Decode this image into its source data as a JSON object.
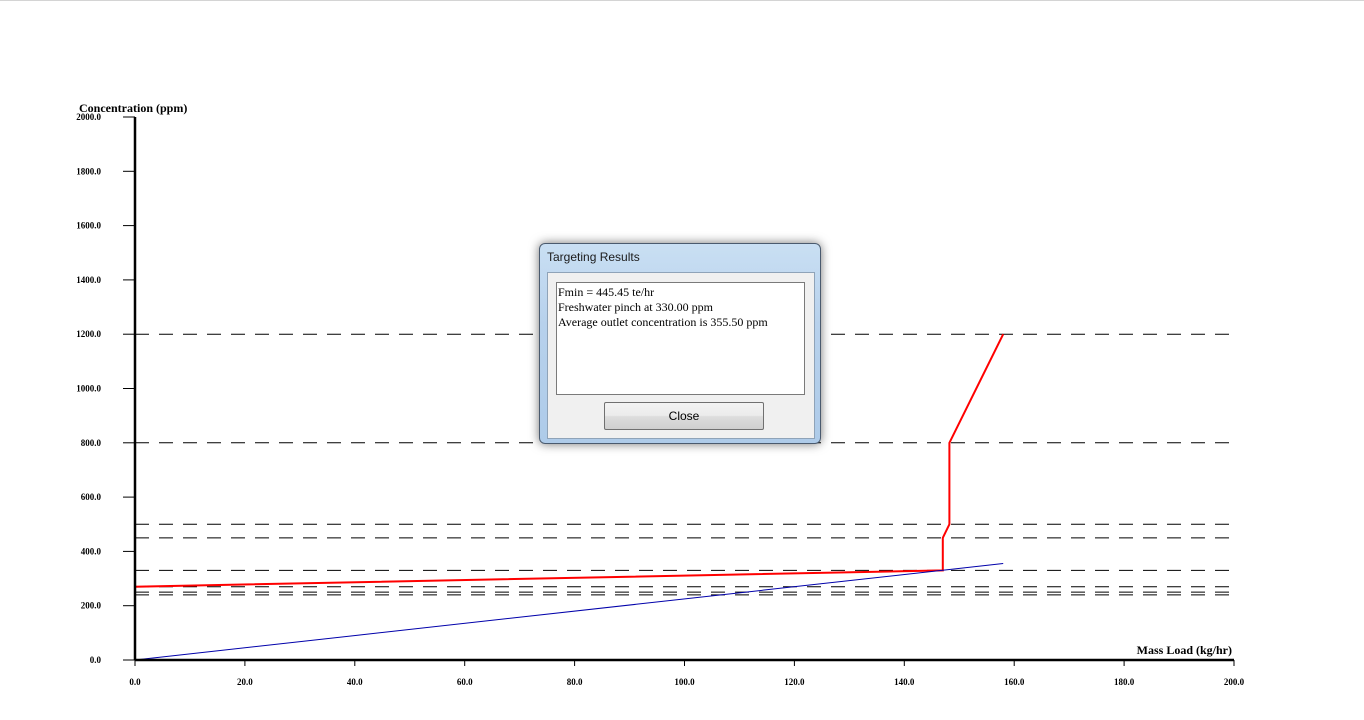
{
  "chart_data": {
    "type": "line",
    "xlabel": "Mass Load (kg/hr)",
    "ylabel": "Concentration (ppm)",
    "xlim": [
      0,
      200
    ],
    "ylim": [
      0,
      2000
    ],
    "x_ticks": [
      0,
      20,
      40,
      60,
      80,
      100,
      120,
      140,
      160,
      180,
      200
    ],
    "x_tick_labels": [
      "0.0",
      "20.0",
      "40.0",
      "60.0",
      "80.0",
      "100.0",
      "120.0",
      "140.0",
      "160.0",
      "180.0",
      "200.0"
    ],
    "y_ticks": [
      0,
      200,
      400,
      600,
      800,
      1000,
      1200,
      1400,
      1600,
      1800,
      2000
    ],
    "y_tick_labels": [
      "0.0",
      "200.0",
      "400.0",
      "600.0",
      "800.0",
      "1000.0",
      "1200.0",
      "1400.0",
      "1600.0",
      "1800.0",
      "2000.0"
    ],
    "reference_lines_y": [
      1200,
      800,
      500,
      450,
      330,
      270,
      250,
      240
    ],
    "series": [
      {
        "color": "#ff0000",
        "points": [
          [
            0,
            240
          ],
          [
            0,
            270
          ],
          [
            147,
            330
          ],
          [
            147,
            450
          ],
          [
            148.2,
            500
          ],
          [
            148.2,
            800
          ],
          [
            158,
            1200
          ]
        ]
      },
      {
        "color": "#0000aa",
        "points": [
          [
            0,
            0
          ],
          [
            158,
            355.5
          ]
        ]
      }
    ]
  },
  "dialog": {
    "title": "Targeting Results",
    "results": [
      "Fmin = 445.45 te/hr",
      "Freshwater pinch at 330.00 ppm",
      "Average outlet concentration is 355.50 ppm"
    ],
    "close_label": "Close"
  }
}
